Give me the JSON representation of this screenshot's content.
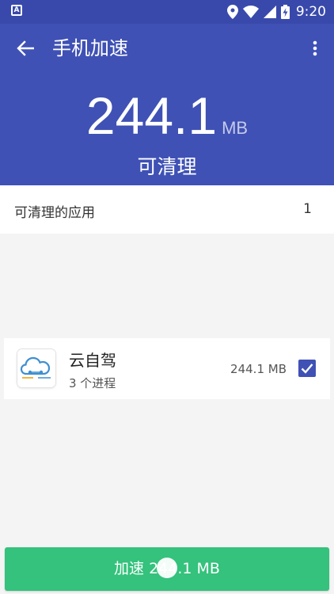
{
  "status_bar": {
    "notification_icon_letter": "A",
    "time": "9:20",
    "icons": [
      "location-icon",
      "wifi-icon",
      "signal-icon",
      "battery-charging-icon"
    ]
  },
  "toolbar": {
    "title": "手机加速",
    "back_icon": "arrow-left-icon",
    "more_icon": "more-vert-icon"
  },
  "summary": {
    "size_value": "244.1",
    "size_unit": "MB",
    "label": "可清理"
  },
  "section": {
    "label": "可清理的应用",
    "count": "1"
  },
  "apps": [
    {
      "name": "云自驾",
      "processes": "3 个进程",
      "size": "244.1 MB",
      "checked": true
    }
  ],
  "boost_button": {
    "label": "加速 244.1 MB"
  },
  "colors": {
    "primary": "#3f51b5",
    "status_bar": "#3949ab",
    "accent_green": "#34c27c",
    "background": "#f4f4f4"
  }
}
